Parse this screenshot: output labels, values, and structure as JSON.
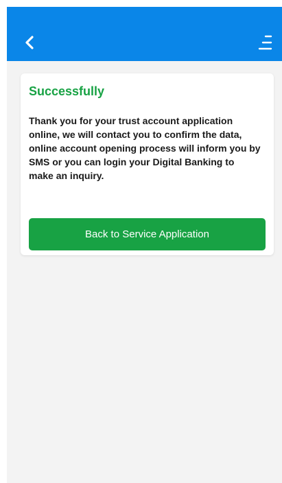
{
  "header": {
    "back_icon": "chevron-left-icon",
    "menu_icon": "menu-icon",
    "background_color": "#0a86e8"
  },
  "result_card": {
    "title": "Successfully",
    "title_color": "#18a244",
    "message": "Thank you for your trust account application online, we will contact you to confirm the data, online account opening process will inform you by SMS or you can login your Digital Banking to make an inquiry.",
    "button_label": "Back to Service Application",
    "button_color": "#18a244"
  }
}
